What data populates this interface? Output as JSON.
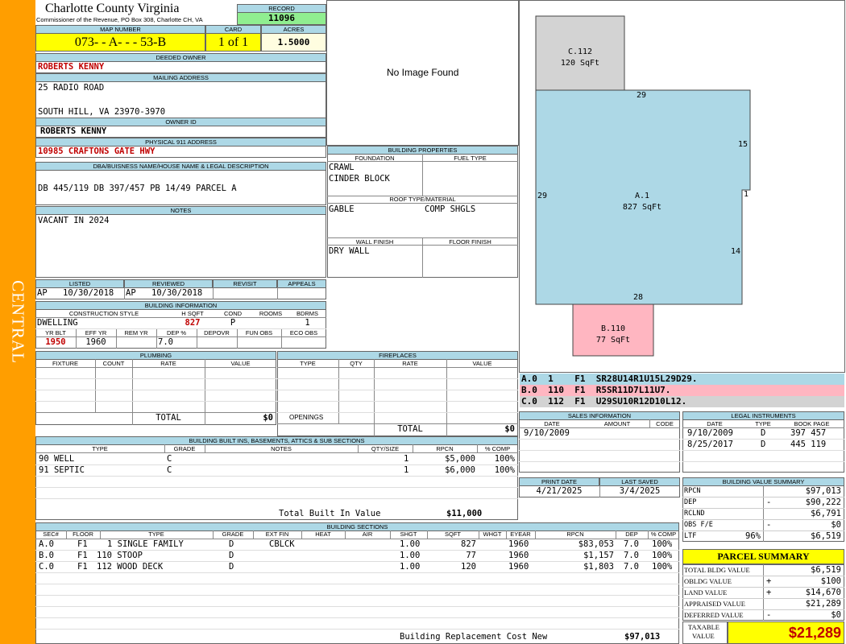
{
  "sidebar_label": "CENTRAL",
  "header": {
    "county": "Charlotte County Virginia",
    "subtitle": "Commissioner of the Revenue, PO Box 308, Charlotte CH, VA",
    "record_label": "RECORD",
    "record": "11096",
    "map_label": "MAP NUMBER",
    "map_number": "073- - A- - - 53-B",
    "card_label": "CARD",
    "card": "1 of 1",
    "acres_label": "ACRES",
    "acres": "1.5000"
  },
  "owner": {
    "deeded_label": "DEEDED OWNER",
    "deeded": "ROBERTS KENNY",
    "mailing_label": "MAILING ADDRESS",
    "addr1": "25 RADIO ROAD",
    "addr2": "SOUTH HILL, VA 23970-3970",
    "owner_id_label": "OWNER ID",
    "owner_id": "ROBERTS KENNY",
    "physical_label": "PHYSICAL 911 ADDRESS",
    "physical": "10985 CRAFTONS GATE HWY",
    "legal_label": "DBA/BUISNESS NAME/HOUSE NAME & LEGAL DESCRIPTION",
    "legal": "DB 445/119 DB 397/457 PB 14/49 PARCEL A",
    "notes_label": "NOTES",
    "notes": "VACANT IN 2024"
  },
  "photo": {
    "text": "No Image Found"
  },
  "building_props": {
    "title": "BUILDING PROPERTIES",
    "foundation_label": "FOUNDATION",
    "fuel_label": "FUEL TYPE",
    "foundation1": "CRAWL",
    "foundation2": "CINDER BLOCK",
    "roof_label": "ROOF TYPE/MATERIAL",
    "roof_type": "GABLE",
    "roof_material": "COMP SHGLS",
    "wall_label": "WALL FINISH",
    "floor_label": "FLOOR FINISH",
    "wall": "DRY WALL"
  },
  "sketch": {
    "c_label": "C.112",
    "c_area": "120 SqFt",
    "a_label": "A.1",
    "a_area": "827 SqFt",
    "b_label": "B.110",
    "b_area": "77 SqFt",
    "dim_top": "29",
    "dim_left": "29",
    "dim_right1": "15",
    "dim_right2": "1",
    "dim_right3": "14",
    "dim_bottom": "28",
    "colors": {
      "c": "#d3d3d3",
      "a": "#add8e6",
      "b": "#ffb6c1"
    }
  },
  "vectors": [
    {
      "text": "A.0  1    F1  SR28U14R1U15L29D29.",
      "color": "#add8e6"
    },
    {
      "text": "B.0  110  F1  R5SR11D7L11U7.",
      "color": "#ffb6c1"
    },
    {
      "text": "C.0  112  F1  U29SU10R12D10L12.",
      "color": "#d3d3d3"
    }
  ],
  "review": {
    "listed_label": "LISTED",
    "reviewed_label": "REVIEWED",
    "revisit_label": "REVISIT",
    "appeals_label": "APPEALS",
    "listed_by": "AP",
    "listed_date": "10/30/2018",
    "reviewed_by": "AP",
    "reviewed_date": "10/30/2018"
  },
  "bldg_info": {
    "title": "BUILDING INFORMATION",
    "style_label": "CONSTRUCTION STYLE",
    "hsqft_label": "H SQFT",
    "cond_label": "COND",
    "rooms_label": "ROOMS",
    "bdrms_label": "BDRMS",
    "style": "DWELLING",
    "hsqft": "827",
    "cond": "P",
    "bdrms": "1",
    "yrblt_label": "YR BLT",
    "effyr_label": "EFF YR",
    "remyr_label": "REM YR",
    "dep_label": "DEP %",
    "depovr_label": "DEPOVR",
    "funobs_label": "FUN OBS",
    "ecoobs_label": "ECO OBS",
    "yrblt": "1950",
    "effyr": "1960",
    "dep": "7.0"
  },
  "plumbing": {
    "title": "PLUMBING",
    "fixture_label": "FIXTURE",
    "count_label": "COUNT",
    "rate_label": "RATE",
    "value_label": "VALUE",
    "total_label": "TOTAL",
    "total": "$0"
  },
  "fireplaces": {
    "title": "FIREPLACES",
    "type_label": "TYPE",
    "qty_label": "QTY",
    "rate_label": "RATE",
    "value_label": "VALUE",
    "openings_label": "OPENINGS",
    "total_label": "TOTAL",
    "total": "$0"
  },
  "sales": {
    "title": "SALES INFORMATION",
    "date_label": "DATE",
    "amount_label": "AMOUNT",
    "code_label": "CODE",
    "rows": [
      {
        "date": "9/10/2009",
        "amount": "",
        "code": ""
      }
    ]
  },
  "legal_inst": {
    "title": "LEGAL INSTRUMENTS",
    "date_label": "DATE",
    "type_label": "TYPE",
    "book_label": "BOOK PAGE",
    "rows": [
      {
        "date": "9/10/2009",
        "type": "D",
        "book": "397 457"
      },
      {
        "date": "8/25/2017",
        "type": "D",
        "book": "445 119"
      }
    ]
  },
  "dates": {
    "print_label": "PRINT DATE",
    "saved_label": "LAST SAVED",
    "print": "4/21/2025",
    "saved": "3/4/2025"
  },
  "builtins": {
    "title": "BUILDING BUILT INS, BASEMENTS, ATTICS & SUB SECTIONS",
    "type_label": "TYPE",
    "grade_label": "GRADE",
    "notes_label": "NOTES",
    "qty_label": "QTY/SIZE",
    "rpcn_label": "RPCN",
    "comp_label": "% COMP",
    "rows": [
      {
        "type": "90 WELL",
        "grade": "C",
        "qty": "1",
        "rpcn": "$5,000",
        "comp": "100%"
      },
      {
        "type": "91 SEPTIC",
        "grade": "C",
        "qty": "1",
        "rpcn": "$6,000",
        "comp": "100%"
      }
    ],
    "total_label": "Total Built In Value",
    "total": "$11,000"
  },
  "value_summary": {
    "title": "BUILDING VALUE SUMMARY",
    "rows": [
      {
        "label": "RPCN",
        "sign": "",
        "pct": "",
        "value": "$97,013"
      },
      {
        "label": "DEP",
        "sign": "-",
        "pct": "",
        "value": "$90,222"
      },
      {
        "label": "RCLND",
        "sign": "",
        "pct": "",
        "value": "$6,791"
      },
      {
        "label": "OBS F/E",
        "sign": "-",
        "pct": "",
        "value": "$0"
      },
      {
        "label": "LTF",
        "sign": "",
        "pct": "96%",
        "value": "$6,519"
      }
    ]
  },
  "sections": {
    "title": "BUILDING SECTIONS",
    "headers": {
      "sec": "SEC#",
      "floor": "FLOOR",
      "type": "TYPE",
      "grade": "GRADE",
      "extfin": "EXT FIN",
      "heat": "HEAT",
      "air": "AIR",
      "shgt": "SHGT",
      "sqft": "SQFT",
      "whgt": "WHGT",
      "eyear": "EYEAR",
      "rpcn": "RPCN",
      "dep": "DEP",
      "comp": "% COMP"
    },
    "rows": [
      {
        "sec": "A.0",
        "floor": "F1",
        "type": "1 SINGLE FAMILY",
        "grade": "D",
        "extfin": "CBLCK",
        "shgt": "1.00",
        "sqft": "827",
        "eyear": "1960",
        "rpcn": "$83,053",
        "dep": "7.0",
        "comp": "100%"
      },
      {
        "sec": "B.0",
        "floor": "F1",
        "type": "110 STOOP",
        "grade": "D",
        "extfin": "",
        "shgt": "1.00",
        "sqft": "77",
        "eyear": "1960",
        "rpcn": "$1,157",
        "dep": "7.0",
        "comp": "100%"
      },
      {
        "sec": "C.0",
        "floor": "F1",
        "type": "112 WOOD DECK",
        "grade": "D",
        "extfin": "",
        "shgt": "1.00",
        "sqft": "120",
        "eyear": "1960",
        "rpcn": "$1,803",
        "dep": "7.0",
        "comp": "100%"
      }
    ],
    "total_label": "Building Replacement Cost New",
    "total": "$97,013"
  },
  "parcel": {
    "title": "PARCEL SUMMARY",
    "rows": [
      {
        "label": "TOTAL BLDG VALUE",
        "sign": "",
        "value": "$6,519"
      },
      {
        "label": "OBLDG VALUE",
        "sign": "+",
        "value": "$100"
      },
      {
        "label": "LAND VALUE",
        "sign": "+",
        "value": "$14,670"
      },
      {
        "label": "APPRAISED VALUE",
        "sign": "",
        "value": "$21,289"
      },
      {
        "label": "DEFERRED VALUE",
        "sign": "-",
        "value": "$0"
      }
    ],
    "taxable_label1": "TAXABLE",
    "taxable_label2": "VALUE",
    "taxable": "$21,289"
  }
}
